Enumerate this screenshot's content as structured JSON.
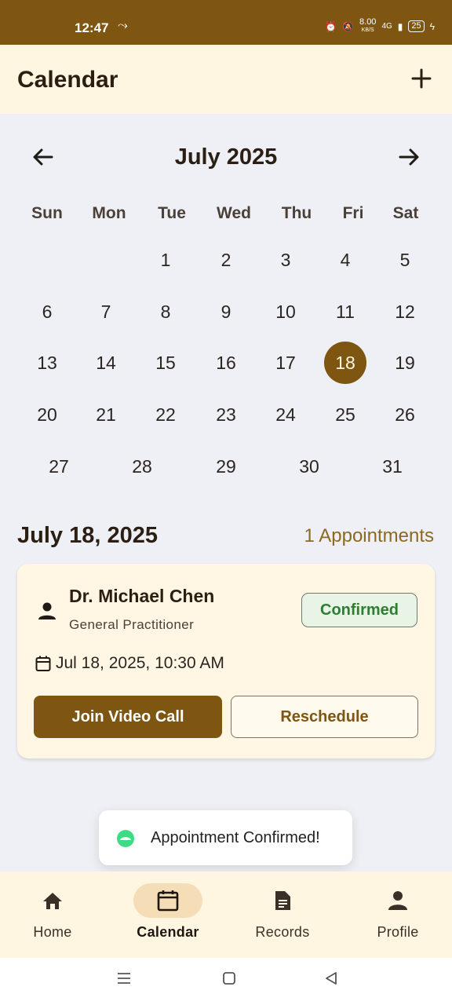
{
  "status_bar": {
    "time": "12:47",
    "net_speed": "8.00",
    "net_unit": "KB/S",
    "signal": "4G",
    "battery": "25"
  },
  "app_bar": {
    "title": "Calendar",
    "add_icon": "plus-icon"
  },
  "calendar": {
    "month_title": "July 2025",
    "weekdays": [
      "Sun",
      "Mon",
      "Tue",
      "Wed",
      "Thu",
      "Fri",
      "Sat"
    ],
    "selected_day": "18",
    "weeks": [
      [
        "",
        "",
        "1",
        "2",
        "3",
        "4",
        "5"
      ],
      [
        "6",
        "7",
        "8",
        "9",
        "10",
        "11",
        "12"
      ],
      [
        "13",
        "14",
        "15",
        "16",
        "17",
        "18",
        "19"
      ],
      [
        "20",
        "21",
        "22",
        "23",
        "24",
        "25",
        "26"
      ],
      [
        "27",
        "28",
        "29",
        "30",
        "31"
      ]
    ]
  },
  "selected_date": {
    "heading": "July 18, 2025",
    "count": "1 Appointments"
  },
  "appointment": {
    "doctor": "Dr. Michael Chen",
    "specialty": "General Practitioner",
    "status": "Confirmed",
    "datetime": "Jul 18, 2025, 10:30 AM",
    "join_label": "Join Video Call",
    "reschedule_label": "Reschedule"
  },
  "toast": {
    "message": "Appointment Confirmed!"
  },
  "bottom_nav": [
    {
      "label": "Home",
      "icon": "home-icon"
    },
    {
      "label": "Calendar",
      "icon": "calendar-icon",
      "active": true
    },
    {
      "label": "Records",
      "icon": "document-icon"
    },
    {
      "label": "Profile",
      "icon": "person-icon"
    }
  ],
  "colors": {
    "brand": "#7E5511",
    "app_bar_bg": "#FFF6E2",
    "confirmed": "#2E7D32",
    "count_text": "#8A6A1E"
  }
}
